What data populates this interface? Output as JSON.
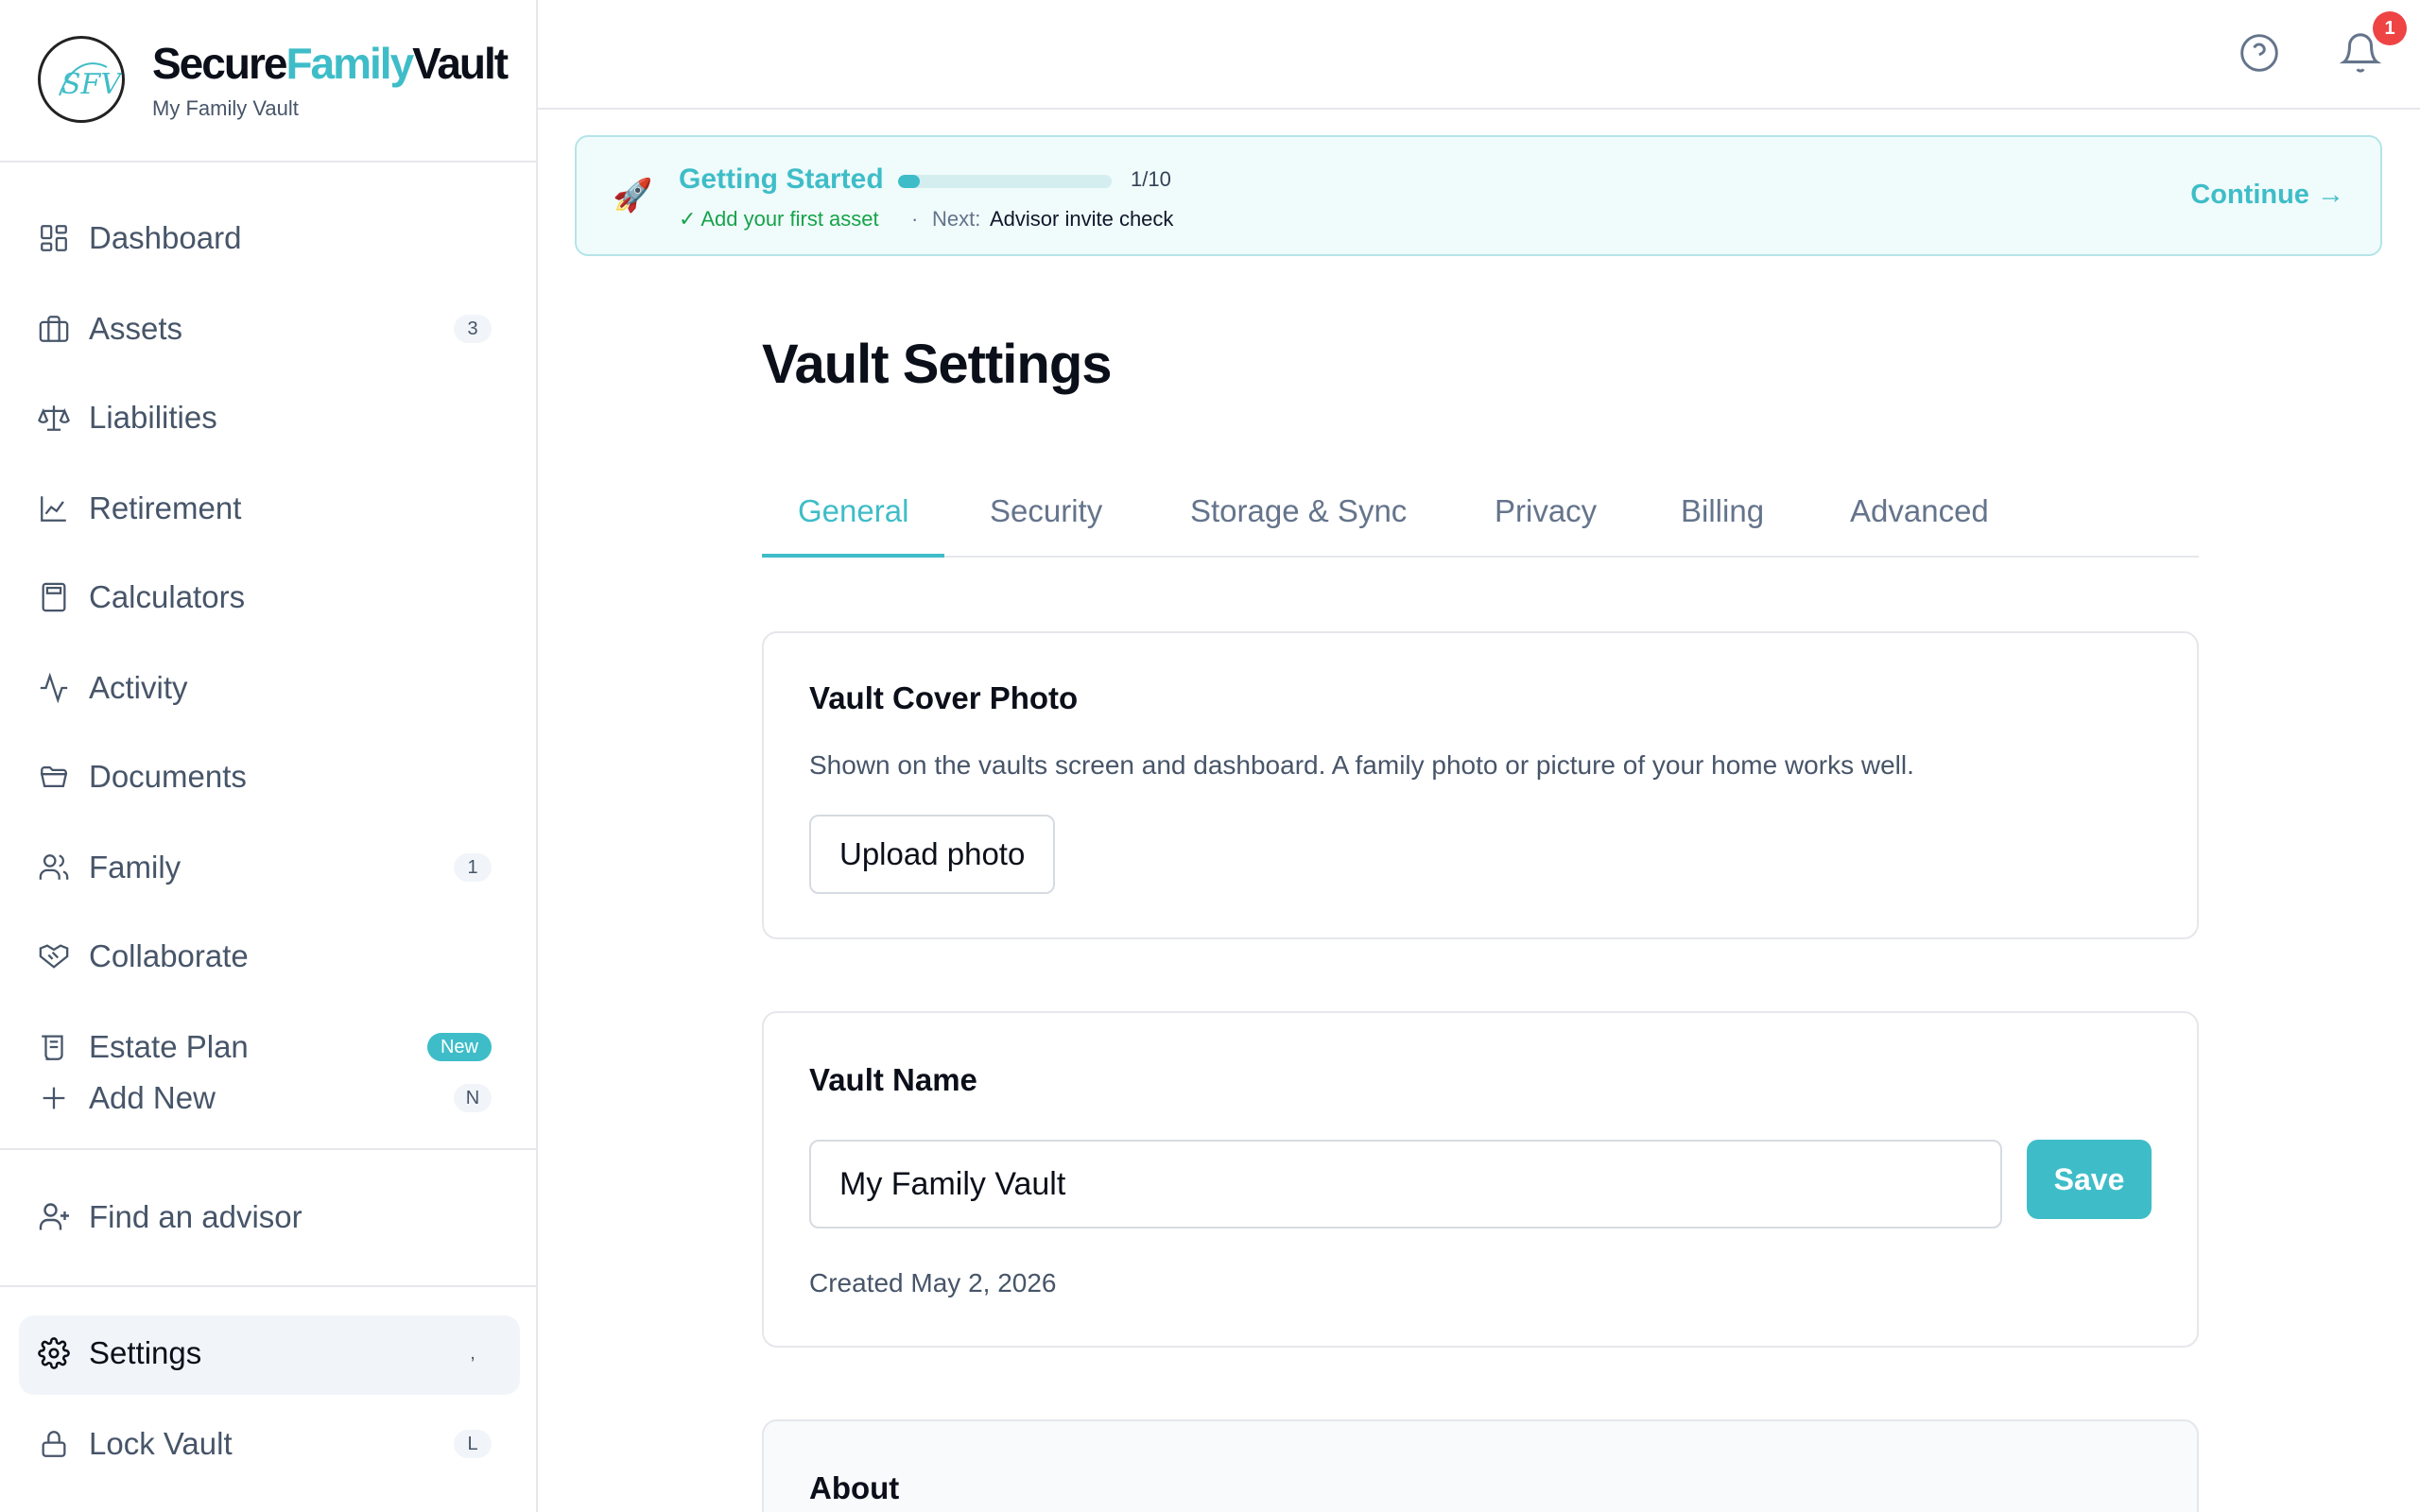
{
  "brand": {
    "name_part1": "Secure",
    "name_part2": "Family",
    "name_part3": "Vault",
    "subtitle": "My Family Vault",
    "accent_color": "#3ebdc8"
  },
  "sidebar": {
    "items": [
      {
        "label": "Dashboard",
        "icon": "dashboard-icon"
      },
      {
        "label": "Assets",
        "icon": "briefcase-icon",
        "badge": "3"
      },
      {
        "label": "Liabilities",
        "icon": "scale-icon"
      },
      {
        "label": "Retirement",
        "icon": "line-chart-icon"
      },
      {
        "label": "Calculators",
        "icon": "calculator-icon"
      },
      {
        "label": "Activity",
        "icon": "activity-icon"
      },
      {
        "label": "Documents",
        "icon": "folder-icon"
      },
      {
        "label": "Family",
        "icon": "users-icon",
        "badge": "1"
      },
      {
        "label": "Collaborate",
        "icon": "handshake-icon"
      },
      {
        "label": "Estate Plan",
        "icon": "scroll-icon",
        "badge": "New"
      },
      {
        "label": "Add New",
        "icon": "plus-icon",
        "badge": "N"
      }
    ],
    "find_advisor": "Find an advisor",
    "settings": {
      "label": "Settings",
      "shortcut": ","
    },
    "lock": {
      "label": "Lock Vault",
      "shortcut": "L"
    }
  },
  "header": {
    "notification_count": "1"
  },
  "getting_started": {
    "title": "Getting Started",
    "progress_text": "1/10",
    "progress_fraction": 0.1,
    "completed": "✓ Add your first asset",
    "separator": "·",
    "next_label": "Next:",
    "next_task": "Advisor invite check",
    "continue_label": "Continue →"
  },
  "main": {
    "title": "Vault Settings",
    "tabs": [
      {
        "label": "General",
        "active": true
      },
      {
        "label": "Security"
      },
      {
        "label": "Storage & Sync"
      },
      {
        "label": "Privacy"
      },
      {
        "label": "Billing"
      },
      {
        "label": "Advanced"
      }
    ],
    "cover_photo": {
      "title": "Vault Cover Photo",
      "description": "Shown on the vaults screen and dashboard. A family photo or picture of your home works well.",
      "button": "Upload photo"
    },
    "vault_name": {
      "title": "Vault Name",
      "value": "My Family Vault",
      "save_label": "Save",
      "created": "Created May 2, 2026"
    },
    "about": {
      "title": "About"
    }
  }
}
